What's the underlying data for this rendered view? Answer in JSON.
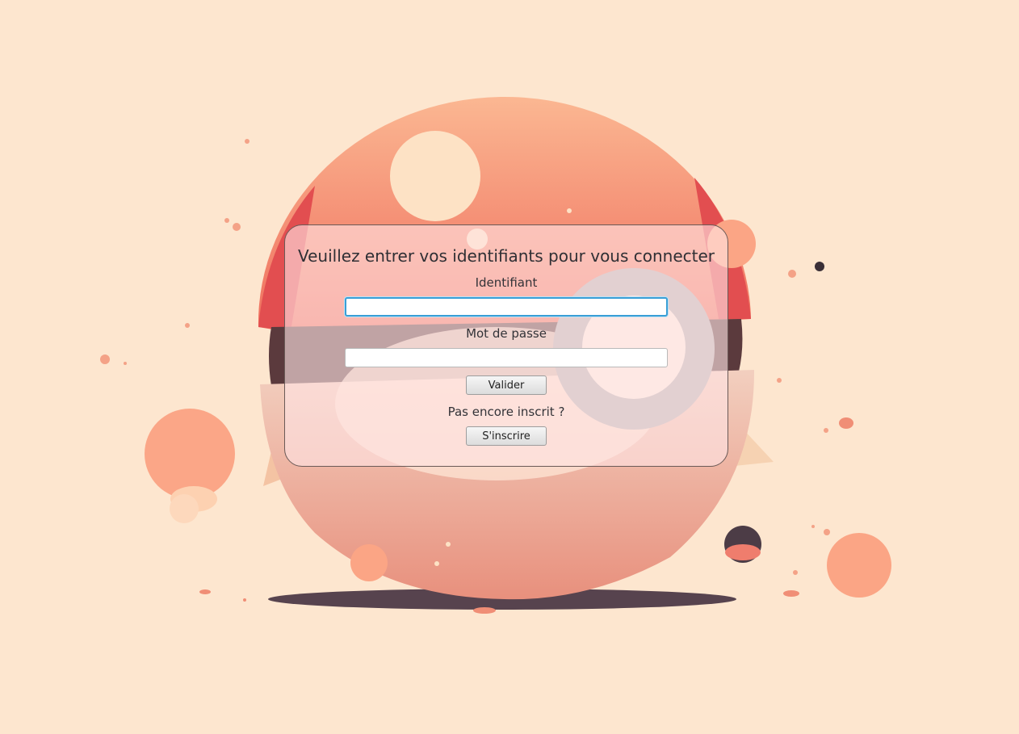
{
  "login": {
    "title": "Veuillez entrer vos identifiants pour vous connecter",
    "identifier_label": "Identifiant",
    "identifier_value": "",
    "password_label": "Mot de passe",
    "password_value": "",
    "submit_label": "Valider",
    "register_prompt": "Pas encore inscrit ?",
    "register_label": "S'inscrire"
  },
  "colors": {
    "background": "#fde6cf",
    "ball_top": "#f48b7a",
    "ball_bottom": "#e89a8a",
    "focus_ring": "#3a9fd6"
  },
  "icons": {
    "background": "pokeball-illustration"
  }
}
